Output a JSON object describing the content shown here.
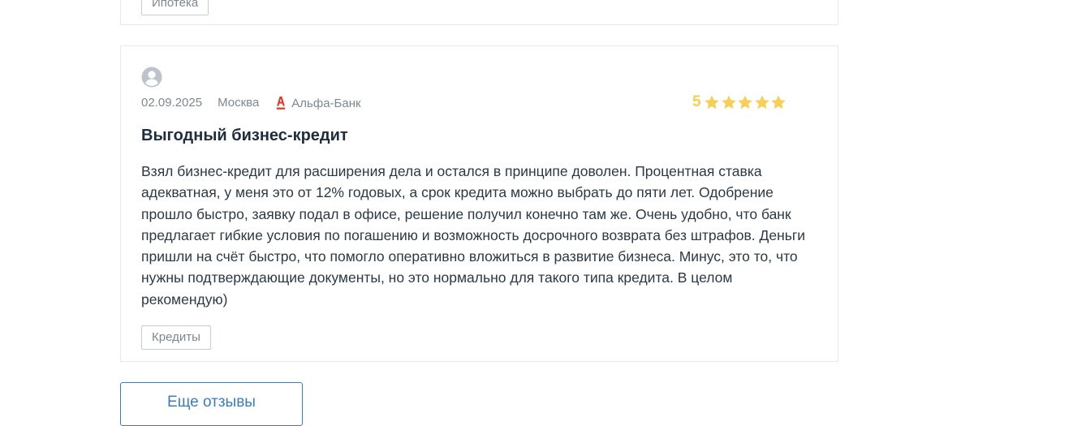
{
  "previous_review": {
    "tag": "Ипотека"
  },
  "review": {
    "avatar_icon": "user-avatar-icon",
    "date": "02.09.2025",
    "city": "Москва",
    "bank_name": "Альфа-Банк",
    "bank_logo_icon": "alfa-bank-logo-icon",
    "rating_value": "5",
    "rating_stars": 5,
    "rating_color": "#f6cf54",
    "title": "Выгодный бизнес-кредит",
    "text": "Взял бизнес-кредит для расширения дела и остался в принципе доволен. Процентная ставка адекватная, у меня это от 12% годовых, а срок кредита можно выбрать до пяти лет. Одобрение прошло быстро, заявку подал в офисе, решение получил конечно там же. Очень удобно, что банк предлагает гибкие условия по погашению и возможность досрочного возврата без штрафов. Деньги пришли на счёт быстро, что помогло оперативно вложиться в развитие бизнеса. Минус, это то, что нужны подтверждающие документы, но это нормально для такого типа кредита. В целом рекомендую)",
    "tag": "Кредиты"
  },
  "more_button_label": "Еще отзывы",
  "colors": {
    "accent": "#3a7cc1",
    "bank_brand": "#ef3124",
    "border": "#e6e9ee"
  }
}
